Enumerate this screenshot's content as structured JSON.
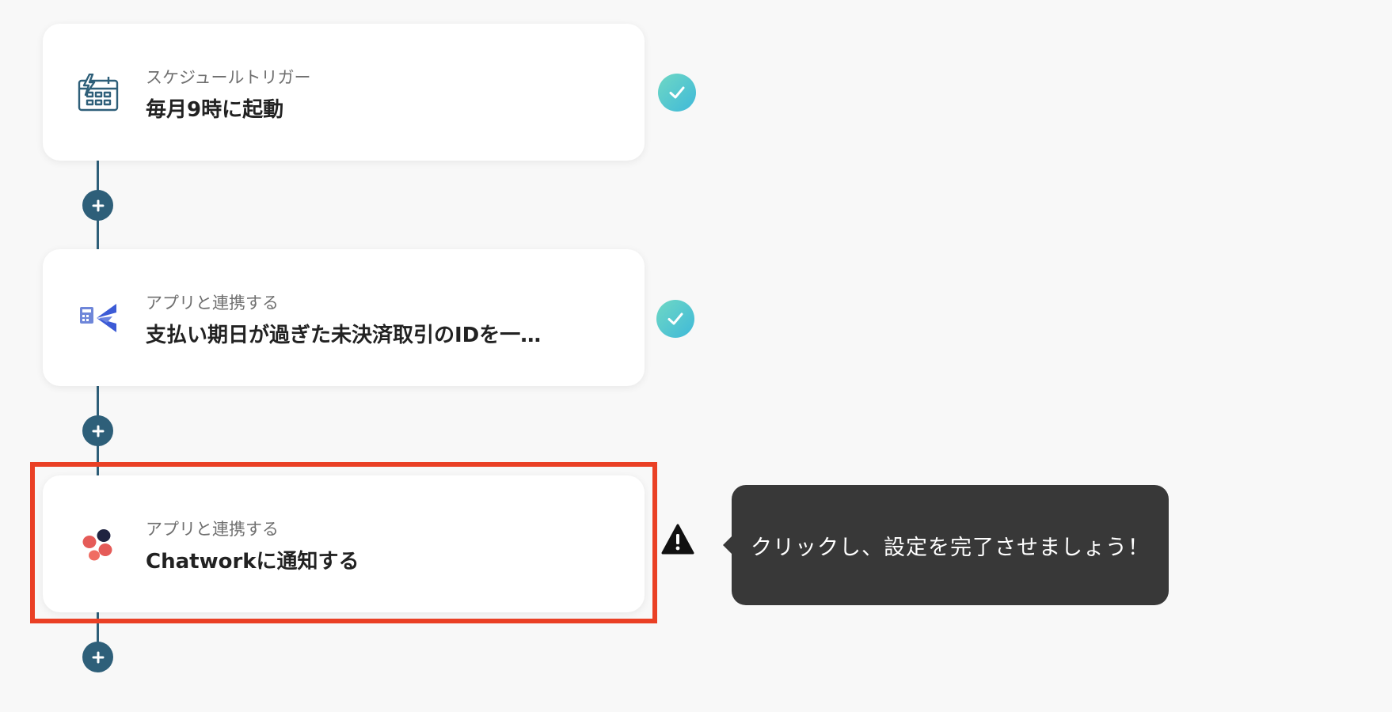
{
  "steps": [
    {
      "subtitle": "スケジュールトリガー",
      "title": "毎月9時に起動",
      "icon": "calendar-schedule-icon",
      "status": "complete"
    },
    {
      "subtitle": "アプリと連携する",
      "title": "支払い期日が過ぎた未決済取引のIDを一…",
      "icon": "freee-accounting-icon",
      "status": "complete"
    },
    {
      "subtitle": "アプリと連携する",
      "title": "Chatworkに通知する",
      "icon": "chatwork-icon",
      "status": "warning"
    }
  ],
  "tooltip": {
    "text": "クリックし、設定を完了させましょう！"
  },
  "colors": {
    "flow_line": "#2e5f79",
    "highlight_border": "#ea4025",
    "tooltip_bg": "#383838",
    "check_gradient_start": "#6fd8c4",
    "check_gradient_end": "#3fb9d9"
  }
}
